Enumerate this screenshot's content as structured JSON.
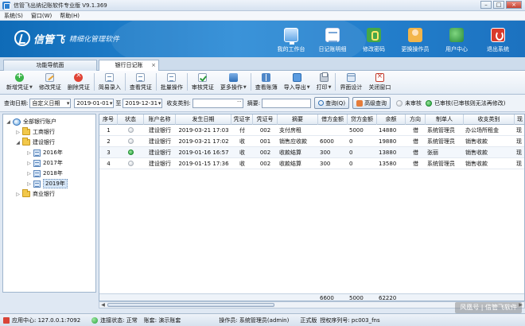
{
  "window": {
    "title": "信管飞出纳记账软件专业版 V9.1.369",
    "buttons": [
      "–",
      "□",
      "×"
    ]
  },
  "menu": [
    "系统(S)",
    "窗口(W)",
    "帮助(H)"
  ],
  "banner": {
    "logo_name": "信管飞",
    "slogan": "精细化管理软件",
    "buttons": [
      {
        "label": "我的工作台",
        "icon": "desktop-icon"
      },
      {
        "label": "日记账明细",
        "icon": "ledger-icon"
      },
      {
        "label": "修改密码",
        "icon": "password-icon"
      },
      {
        "label": "更换操作员",
        "icon": "user-icon"
      },
      {
        "label": "用户中心",
        "icon": "user-center-icon"
      },
      {
        "label": "退出系统",
        "icon": "power-icon"
      }
    ]
  },
  "tabs": [
    {
      "label": "功能导航面"
    },
    {
      "label": "银行日记账",
      "close": "×"
    }
  ],
  "toolbar": [
    {
      "label": "新增凭证",
      "icon": "add-icon"
    },
    {
      "label": "修改凭证",
      "icon": "edit-icon"
    },
    {
      "label": "删除凭证",
      "icon": "delete-icon"
    },
    {
      "label": "简易录入",
      "icon": "quick-entry-icon"
    },
    {
      "label": "查看凭证",
      "icon": "view-icon"
    },
    {
      "label": "批量操作",
      "icon": "batch-icon"
    },
    {
      "label": "审核凭证",
      "icon": "audit-icon"
    },
    {
      "label": "更多操作",
      "icon": "more-icon"
    },
    {
      "label": "查看账簿",
      "icon": "book-icon"
    },
    {
      "label": "导入导出",
      "icon": "import-export-icon"
    },
    {
      "label": "打印",
      "icon": "print-icon"
    },
    {
      "label": "界面设计",
      "icon": "layout-icon"
    },
    {
      "label": "关闭窗口",
      "icon": "close-window-icon"
    }
  ],
  "filter": {
    "date_label": "查询日期:",
    "date_mode": "自定义日期",
    "date_from": "2019-01-01",
    "to_label": "至",
    "date_to": "2019-12-31",
    "category_label": "收支类别:",
    "category_value": "",
    "summary_label": "摘要:",
    "summary_value": "",
    "query_button": "查询(Q)",
    "advanced_button": "高级查询",
    "legend_unaudited": "未审核",
    "legend_audited": "已审核(已审核则无法再修改)"
  },
  "tree": {
    "root": "全部银行账户",
    "items": [
      {
        "label": "工商银行"
      },
      {
        "label": "建设银行"
      },
      {
        "label": "2016年"
      },
      {
        "label": "2017年"
      },
      {
        "label": "2018年"
      },
      {
        "label": "2019年"
      },
      {
        "label": "商业银行"
      }
    ]
  },
  "grid": {
    "columns": [
      "序号",
      "状态",
      "账户名称",
      "发生日期",
      "凭证字",
      "凭证号",
      "摘要",
      "借方金额",
      "贷方金额",
      "余额",
      "方向",
      "制单人",
      "收支类别",
      "现"
    ],
    "rows": [
      {
        "no": "1",
        "status": "unaudited",
        "account": "建设银行",
        "date": "2019-03-21 17:03",
        "word": "付",
        "voucher": "002",
        "summary": "支付房租",
        "debit": "",
        "credit": "5000",
        "balance": "14880",
        "dir": "借",
        "maker": "系统管理员",
        "category": "办公场所租金",
        "extra": "现"
      },
      {
        "no": "2",
        "status": "unaudited",
        "account": "建设银行",
        "date": "2019-03-21 17:02",
        "word": "收",
        "voucher": "001",
        "summary": "销售应收款",
        "debit": "6000",
        "credit": "0",
        "balance": "19880",
        "dir": "借",
        "maker": "系统管理员",
        "category": "销售收款",
        "extra": "现"
      },
      {
        "no": "3",
        "status": "audited",
        "account": "建设银行",
        "date": "2019-01-16 16:57",
        "word": "收",
        "voucher": "002",
        "summary": "收款结算",
        "debit": "300",
        "credit": "0",
        "balance": "13880",
        "dir": "借",
        "maker": "张丽",
        "category": "销售收款",
        "extra": "现"
      },
      {
        "no": "4",
        "status": "unaudited",
        "account": "建设银行",
        "date": "2019-01-15 17:36",
        "word": "收",
        "voucher": "002",
        "summary": "收款结算",
        "debit": "300",
        "credit": "0",
        "balance": "13580",
        "dir": "借",
        "maker": "系统管理员",
        "category": "销售收款",
        "extra": "现"
      }
    ],
    "totals": {
      "debit": "6600",
      "credit": "5000",
      "balance": "62220"
    }
  },
  "status": {
    "app_center": "应用中心: 127.0.0.1:7092",
    "connection": "连接状态: 正常",
    "account_set": "账套: 演示账套",
    "operator": "操作员: 系统管理员(admin)",
    "edition": "正式版",
    "license": "授权序列号: pc003_fns"
  },
  "watermark": "风凰号 | 信管飞软件",
  "colors": {
    "banner": "#1c7bc8",
    "audited": "#23a23a",
    "unaudited": "#c9ced4",
    "close_button": "#c64232"
  }
}
